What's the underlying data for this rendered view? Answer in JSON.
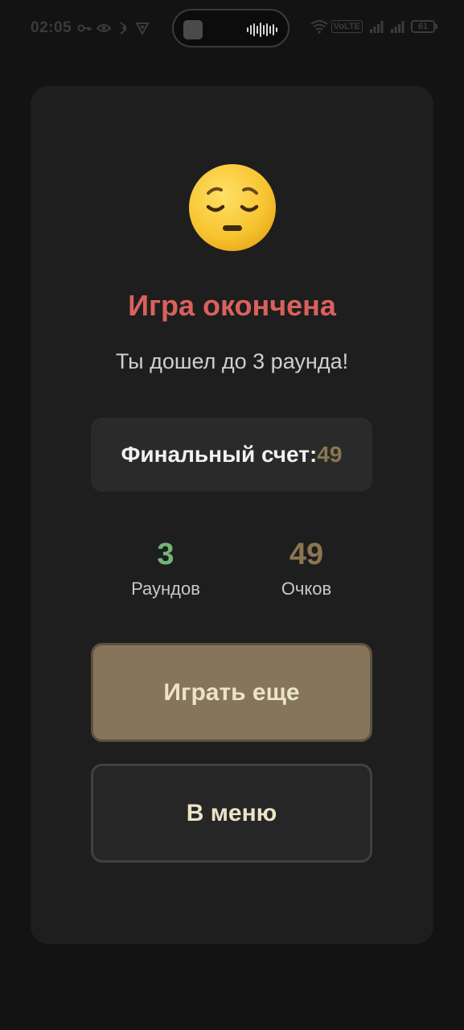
{
  "status_bar": {
    "time": "02:05",
    "battery": "61",
    "volte": "VoLTE",
    "icons": [
      "key-icon",
      "eye-icon",
      "vibrate-icon",
      "vpn-icon",
      "wifi-icon",
      "signal-icon",
      "signal-icon",
      "battery-icon"
    ]
  },
  "game_over": {
    "emoji": "pensive-face",
    "title": "Игра окончена",
    "subtitle": "Ты дошел до 3 раунда!",
    "final_score_label": "Финальный счет:",
    "final_score_value": "49",
    "stats": [
      {
        "value": "3",
        "label": "Раундов",
        "color": "#73b477"
      },
      {
        "value": "49",
        "label": "Очков",
        "color": "#8a7650"
      }
    ],
    "play_again_label": "Играть еще",
    "menu_label": "В меню"
  },
  "colors": {
    "background": "#131313",
    "card": "#1e1e1e",
    "title": "#d9615c",
    "accent": "#86755a"
  }
}
